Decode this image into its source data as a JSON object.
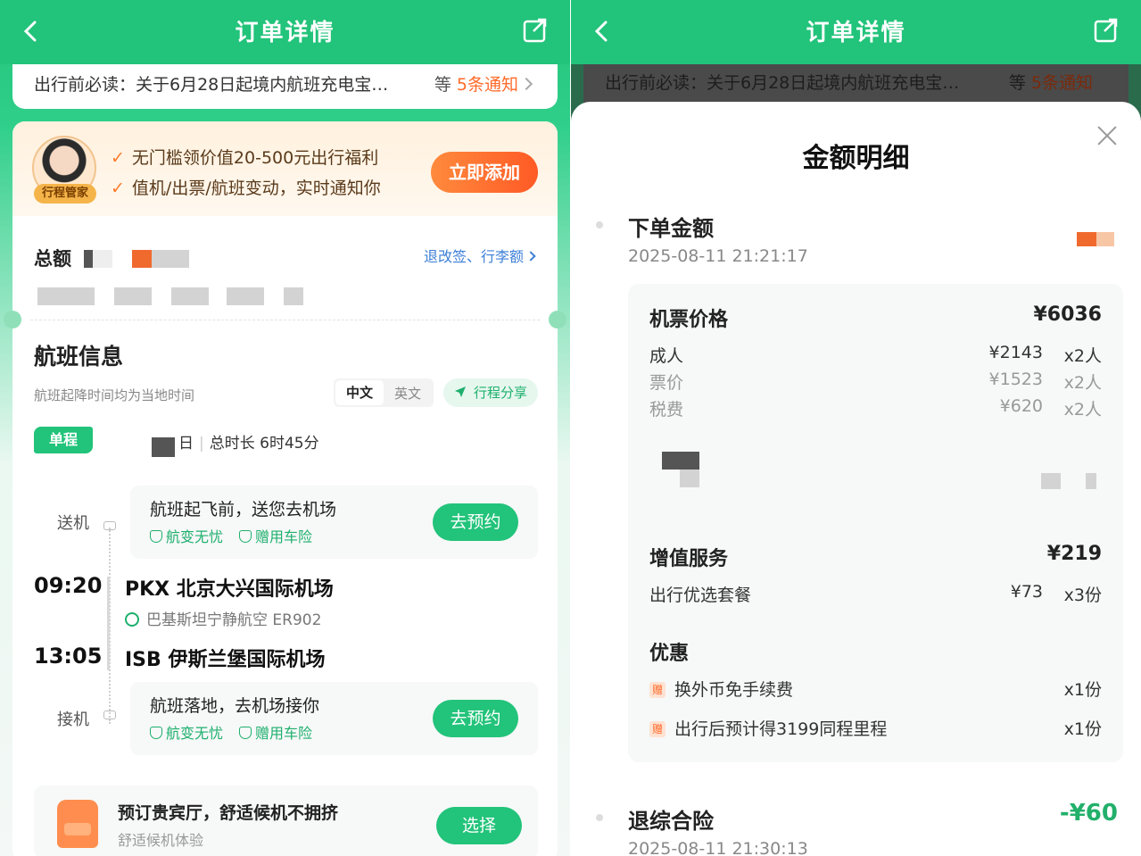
{
  "left": {
    "header": {
      "title": "订单详情"
    },
    "notice": {
      "text": "出行前必读：关于6月28日起境内航班充电宝…",
      "prefix": "等",
      "count": "5条通知"
    },
    "promo": {
      "avatar_tag": "行程管家",
      "line1": "无门槛领价值20-500元出行福利",
      "line2": "值机/出票/航班变动，实时通知你",
      "button": "立即添加"
    },
    "total": {
      "label": "总额",
      "link": "退改签、行李额"
    },
    "flight": {
      "title": "航班信息",
      "subtitle": "航班起降时间均为当地时间",
      "lang_zh": "中文",
      "lang_en": "英文",
      "share": "行程分享",
      "trip_type": "单程",
      "date_suffix": "日",
      "duration": "总时长 6时45分",
      "dropoff": {
        "side": "送机",
        "title": "航班起飞前，送您去机场",
        "tag1": "航变无忧",
        "tag2": "赠用车险",
        "button": "去预约"
      },
      "dep_time": "09:20",
      "dep_airport": "PKX 北京大兴国际机场",
      "airline": "巴基斯坦宁静航空 ER902",
      "arr_time": "13:05",
      "arr_airport": "ISB 伊斯兰堡国际机场",
      "pickup": {
        "side": "接机",
        "title": "航班落地，去机场接你",
        "tag1": "航变无忧",
        "tag2": "赠用车险",
        "button": "去预约"
      }
    },
    "lounge": {
      "title": "预订贵宾厅，舒适候机不拥挤",
      "subtitle": "舒适候机体验",
      "button": "选择"
    }
  },
  "right": {
    "header": {
      "title": "订单详情"
    },
    "notice": {
      "text": "出行前必读：关于6月28日起境内航班充电宝…",
      "prefix": "等",
      "count": "5条通知"
    },
    "sheet": {
      "title": "金额明细",
      "order": {
        "label": "下单金额",
        "date": "2025-08-11 21:21:17"
      },
      "ticket": {
        "label": "机票价格",
        "amount": "¥6036",
        "rows": [
          {
            "label": "成人",
            "price": "¥2143",
            "qty": "x2人"
          },
          {
            "label": "票价",
            "price": "¥1523",
            "qty": "x2人"
          },
          {
            "label": "税费",
            "price": "¥620",
            "qty": "x2人"
          }
        ]
      },
      "value_added": {
        "label": "增值服务",
        "amount": "¥219",
        "item": "出行优选套餐",
        "price": "¥73",
        "qty": "x3份"
      },
      "discount": {
        "label": "优惠",
        "badge": "赠",
        "items": [
          {
            "label": "换外币免手续费",
            "qty": "x1份"
          },
          {
            "label": "出行后预计得3199同程里程",
            "qty": "x1份"
          }
        ]
      },
      "refund": {
        "label": "退综合险",
        "amount": "-¥60",
        "date": "2025-08-11 21:30:13"
      }
    }
  }
}
